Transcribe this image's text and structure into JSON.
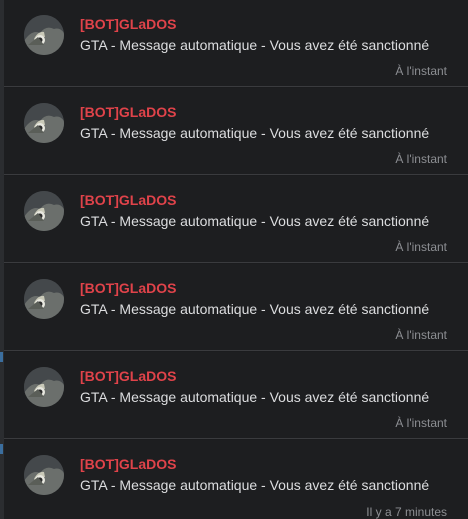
{
  "notifications": [
    {
      "title": "[BOT]GLaDOS",
      "message": "GTA - Message automatique - Vous avez été sanctionné",
      "time": "À l'instant"
    },
    {
      "title": "[BOT]GLaDOS",
      "message": "GTA - Message automatique - Vous avez été sanctionné",
      "time": "À l'instant"
    },
    {
      "title": "[BOT]GLaDOS",
      "message": "GTA - Message automatique - Vous avez été sanctionné",
      "time": "À l'instant"
    },
    {
      "title": "[BOT]GLaDOS",
      "message": "GTA - Message automatique - Vous avez été sanctionné",
      "time": "À l'instant"
    },
    {
      "title": "[BOT]GLaDOS",
      "message": "GTA - Message automatique - Vous avez été sanctionné",
      "time": "À l'instant"
    },
    {
      "title": "[BOT]GLaDOS",
      "message": "GTA - Message automatique - Vous avez été sanctionné",
      "time": "Il y a 7 minutes"
    }
  ],
  "colors": {
    "title": "#e0434a",
    "message": "#dcdddf",
    "time": "#8d8f93",
    "background": "#1d1e20",
    "divider": "#3a3b3e"
  },
  "icons": {
    "avatar": "glados-avatar-icon"
  }
}
